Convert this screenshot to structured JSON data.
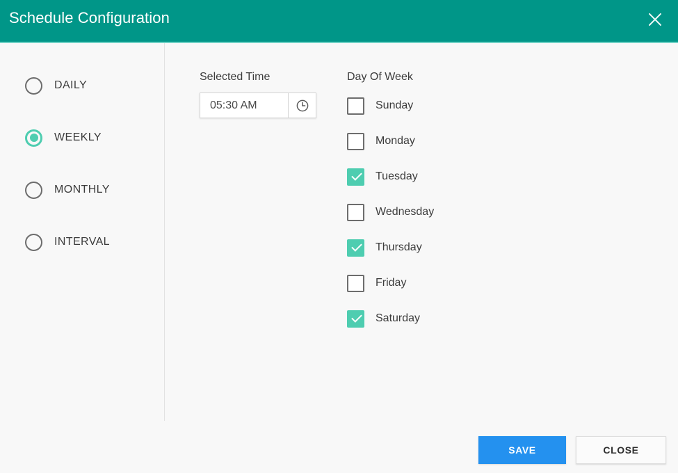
{
  "dialog": {
    "title": "Schedule Configuration",
    "close_icon": "close-icon",
    "header_color": "#009688",
    "accent_color": "#4ecdb0",
    "primary_button_color": "#2491ef"
  },
  "schedule_modes": {
    "selected": "WEEKLY",
    "items": [
      {
        "label": "DAILY",
        "checked": false
      },
      {
        "label": "WEEKLY",
        "checked": true
      },
      {
        "label": "MONTHLY",
        "checked": false
      },
      {
        "label": "INTERVAL",
        "checked": false
      }
    ]
  },
  "time_picker": {
    "label": "Selected Time",
    "value": "05:30 AM",
    "placeholder": "hh:mm AM",
    "button_icon": "clock-icon"
  },
  "day_of_week": {
    "label": "Day Of Week",
    "items": [
      {
        "label": "Sunday",
        "checked": false
      },
      {
        "label": "Monday",
        "checked": false
      },
      {
        "label": "Tuesday",
        "checked": true
      },
      {
        "label": "Wednesday",
        "checked": false
      },
      {
        "label": "Thursday",
        "checked": true
      },
      {
        "label": "Friday",
        "checked": false
      },
      {
        "label": "Saturday",
        "checked": true
      }
    ]
  },
  "footer": {
    "save_label": "SAVE",
    "close_label": "CLOSE"
  }
}
